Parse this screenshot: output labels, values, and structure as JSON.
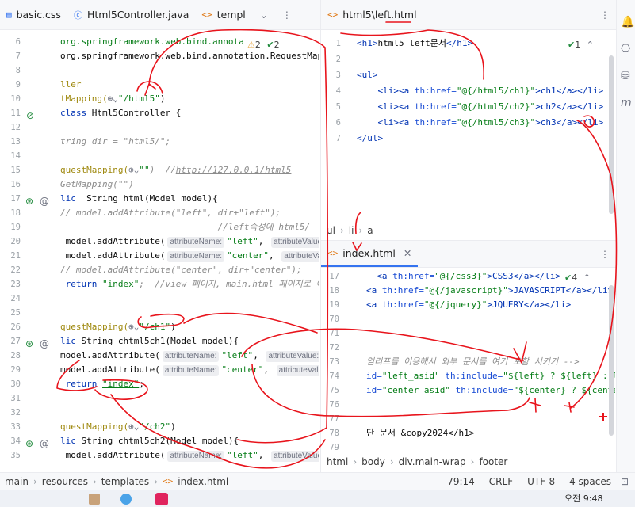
{
  "left_tabs": [
    {
      "icon": "css-file-icon",
      "label": "basic.css"
    },
    {
      "icon": "class-icon",
      "label": "Html5Controller.java"
    },
    {
      "icon": "html-file-icon",
      "label": "templ"
    }
  ],
  "left_tab_chevron": "⌄",
  "left_inspections": {
    "warnings": "2",
    "ok": "2"
  },
  "left_lines": [
    "6",
    "7",
    "8",
    "9",
    "10",
    "11",
    "12",
    "13",
    "14",
    "15",
    "16",
    "17",
    "18",
    "19",
    "20",
    "21",
    "22",
    "23",
    "24",
    "25",
    "26",
    "27",
    "28",
    "29",
    "30",
    "31",
    "32",
    "33",
    "34",
    "35"
  ],
  "left_code": {
    "l6": "org.springframework.web.bind.annotat",
    "l7": "org.springframework.web.bind.annotation.RequestMappi",
    "l9": "ller",
    "l10a": "tMapping(",
    "l10b": "\"/html5\"",
    "l10c": ")",
    "l11a": "class",
    "l11b": " Html5Controller {",
    "l13": "tring dir = \"html5/\";",
    "l15a": "questMapping(",
    "l15b": "\"\"",
    "l15c": ")  //",
    "l15d": "http://127.0.0.1/html5",
    "l16": "GetMapping(\"\")",
    "l17a": "lic",
    "l17b": "  String html(Model model){",
    "l18": "// model.addAttribute(\"left\", dir+\"left\");",
    "l19": "                              //left속성에 html5/",
    "l20a": " model.addAttribute(",
    "l20b": "\"left\"",
    "l21a": " model.addAttribute(",
    "l21b": "\"center\"",
    "l22": "// model.addAttribute(\"center\", dir+\"center\");",
    "l23a": " return ",
    "l23b": "\"index\"",
    "l23c": ";  //view 페이지, main.html 페이지로 이동",
    "l26a": "questMapping(",
    "l26b": "\"/ch1\"",
    "l26c": ")",
    "l27a": "lic",
    "l27b": " String chtml5ch1(Model model){",
    "l28a": "model.addAttribute(",
    "l28b": "\"left\"",
    "l29a": "model.addAttribute(",
    "l29b": "\"center\"",
    "l30a": " return ",
    "l30b": "\"index\"",
    "l30c": ";",
    "l33a": "questMapping(",
    "l33b": "\"/ch2\"",
    "l33c": ")",
    "l34a": "lic",
    "l34b": " String chtml5ch2(Model model){",
    "l35a": " model.addAttribute(",
    "l35b": "\"left\""
  },
  "param_hints": {
    "name": "attributeName:",
    "value": "attributeValue:"
  },
  "right_top_tab": {
    "icon": "html-file-icon",
    "label": "html5\\left.html"
  },
  "right_top_lines": [
    "1",
    "2",
    "3",
    "4",
    "5",
    "6",
    "7"
  ],
  "right_top_code": {
    "l1a": "<h1>",
    "l1b": "html5 left문서",
    "l1c": "</h1>",
    "l3": "<ul>",
    "l4a": "    <li><a ",
    "l4b": "th:href=",
    "l4c": "\"@{/html5/ch1}\"",
    "l4d": ">ch1</a></li>",
    "l5a": "    <li><a ",
    "l5b": "th:href=",
    "l5c": "\"@{/html5/ch2}\"",
    "l5d": ">ch2</a></li>",
    "l6a": "    <li><a ",
    "l6b": "th:href=",
    "l6c": "\"@{/html5/ch3}\"",
    "l6d": ">ch3</a></li>",
    "l7": "</ul>"
  },
  "right_top_check": "1",
  "right_top_breadcrumb": [
    "ul",
    "li",
    "a"
  ],
  "right_bottom_tab": {
    "icon": "html-file-icon",
    "label": "index.html"
  },
  "right_bottom_check": "4",
  "right_bottom_lines": [
    "17",
    "18",
    "19",
    "70",
    "71",
    "72",
    "73",
    "74",
    "75",
    "76",
    "77",
    "78",
    "79"
  ],
  "right_bottom_code": {
    "l17a": "  <a ",
    "l17b": "th:href=",
    "l17c": "\"@{/css3}\"",
    "l17d": ">CSS3</a></li>",
    "l18a": "<a ",
    "l18b": "th:href=",
    "l18c": "\"@{/javascript}\"",
    "l18d": ">JAVASCRIPT</a></li>",
    "l19a": "<a ",
    "l19b": "th:href=",
    "l19c": "\"@{/jquery}\"",
    "l19d": ">JQUERY</a></li>",
    "l73": "임리프를 이용해서 외부 문서를 여기 포함 시키기 -->",
    "l74a": "id=",
    "l74b": "\"left_asid\"",
    "l74c": " th:include=",
    "l74d": "\"${left} ? ${left} : lef",
    "l75a": "id=",
    "l75b": "\"center_asid\"",
    "l75c": " th:include=",
    "l75d": "\"${center} ? ${center}",
    "l78": "단 문서 &copy2024</h1>"
  },
  "right_bottom_breadcrumb": [
    "html",
    "body",
    "div.main-wrap",
    "footer"
  ],
  "status_path": [
    "main",
    "resources",
    "templates",
    "index.html"
  ],
  "status_right": [
    "79:14",
    "CRLF",
    "UTF-8",
    "4 spaces"
  ],
  "taskbar": {
    "time": "오전 9:48"
  },
  "accent": "#3574f0",
  "annotation_color": "#e8141c"
}
